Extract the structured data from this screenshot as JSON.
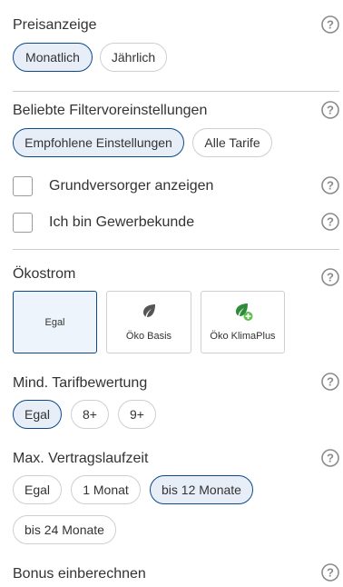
{
  "price_display": {
    "title": "Preisanzeige",
    "options": [
      {
        "label": "Monatlich",
        "selected": true
      },
      {
        "label": "Jährlich",
        "selected": false
      }
    ]
  },
  "filter_presets": {
    "title": "Beliebte Filtervoreinstellungen",
    "options": [
      {
        "label": "Empfohlene Einstellungen",
        "selected": true
      },
      {
        "label": "Alle Tarife",
        "selected": false
      }
    ],
    "checkboxes": [
      {
        "label": "Grundversorger anzeigen",
        "checked": false
      },
      {
        "label": "Ich bin Gewerbekunde",
        "checked": false
      }
    ]
  },
  "eco_power": {
    "title": "Ökostrom",
    "cards": [
      {
        "label": "Egal",
        "selected": true,
        "icon": "none"
      },
      {
        "label": "Öko Basis",
        "selected": false,
        "icon": "leaf-icon"
      },
      {
        "label": "Öko KlimaPlus",
        "selected": false,
        "icon": "leaf-plus-icon"
      }
    ]
  },
  "min_rating": {
    "title": "Mind. Tarifbewertung",
    "options": [
      {
        "label": "Egal",
        "selected": true
      },
      {
        "label": "8+",
        "selected": false
      },
      {
        "label": "9+",
        "selected": false
      }
    ]
  },
  "max_term": {
    "title": "Max. Vertragslaufzeit",
    "options": [
      {
        "label": "Egal",
        "selected": false
      },
      {
        "label": "1 Monat",
        "selected": false
      },
      {
        "label": "bis 12 Monate",
        "selected": true
      },
      {
        "label": "bis 24 Monate",
        "selected": false
      }
    ]
  },
  "bonus": {
    "title": "Bonus einberechnen"
  },
  "colors": {
    "selected_border": "#0b4a8a",
    "selected_fill": "#e7eef7",
    "leaf_gray": "#555555",
    "leaf_green": "#2e8b3a",
    "plus_green": "#5cc04a"
  }
}
